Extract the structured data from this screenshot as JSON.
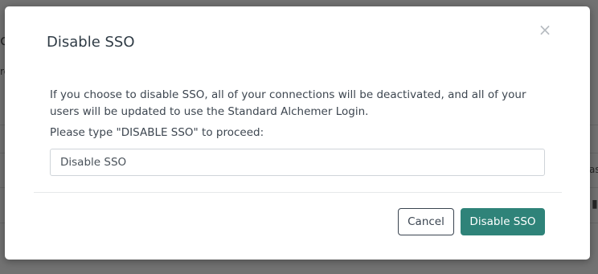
{
  "background": {
    "fragment_left_1": "c",
    "fragment_left_2": "re",
    "fragment_right_1": "as",
    "fragment_right_2": "▮"
  },
  "modal": {
    "title": "Disable SSO",
    "close_glyph": "×",
    "body_text": "If you choose to disable SSO, all of your connections will be deactivated, and all of your users will be updated to use the Standard Alchemer Login.",
    "prompt_label": "Please type \"DISABLE SSO\" to proceed:",
    "input_value": "Disable SSO",
    "cancel_label": "Cancel",
    "confirm_label": "Disable SSO"
  },
  "colors": {
    "primary": "#2f8379",
    "overlay": "#727272",
    "title": "#2f3b45"
  }
}
